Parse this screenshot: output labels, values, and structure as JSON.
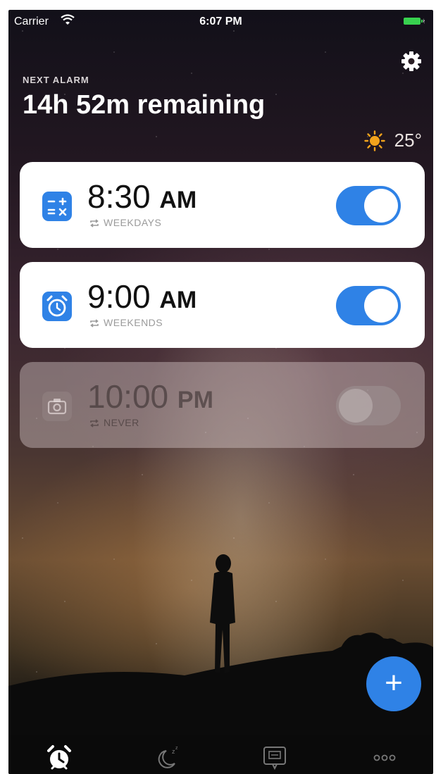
{
  "status_bar": {
    "carrier": "Carrier",
    "time": "6:07 PM"
  },
  "header": {
    "next_alarm_label": "NEXT ALARM",
    "remaining": "14h 52m remaining"
  },
  "weather": {
    "temperature": "25°"
  },
  "alarms": [
    {
      "time": "8:30",
      "period": "AM",
      "repeat": "WEEKDAYS",
      "enabled": true,
      "icon": "calculator-icon"
    },
    {
      "time": "9:00",
      "period": "AM",
      "repeat": "WEEKENDS",
      "enabled": true,
      "icon": "alarm-clock-icon"
    },
    {
      "time": "10:00",
      "period": "PM",
      "repeat": "NEVER",
      "enabled": false,
      "icon": "camera-icon"
    }
  ],
  "add_button": {
    "label": "+"
  },
  "tabs": [
    "alarm-tab",
    "sleep-tab",
    "messages-tab",
    "more-tab"
  ],
  "colors": {
    "accent": "#2f82e6",
    "battery": "#38d14f",
    "sun": "#f2a31c"
  }
}
